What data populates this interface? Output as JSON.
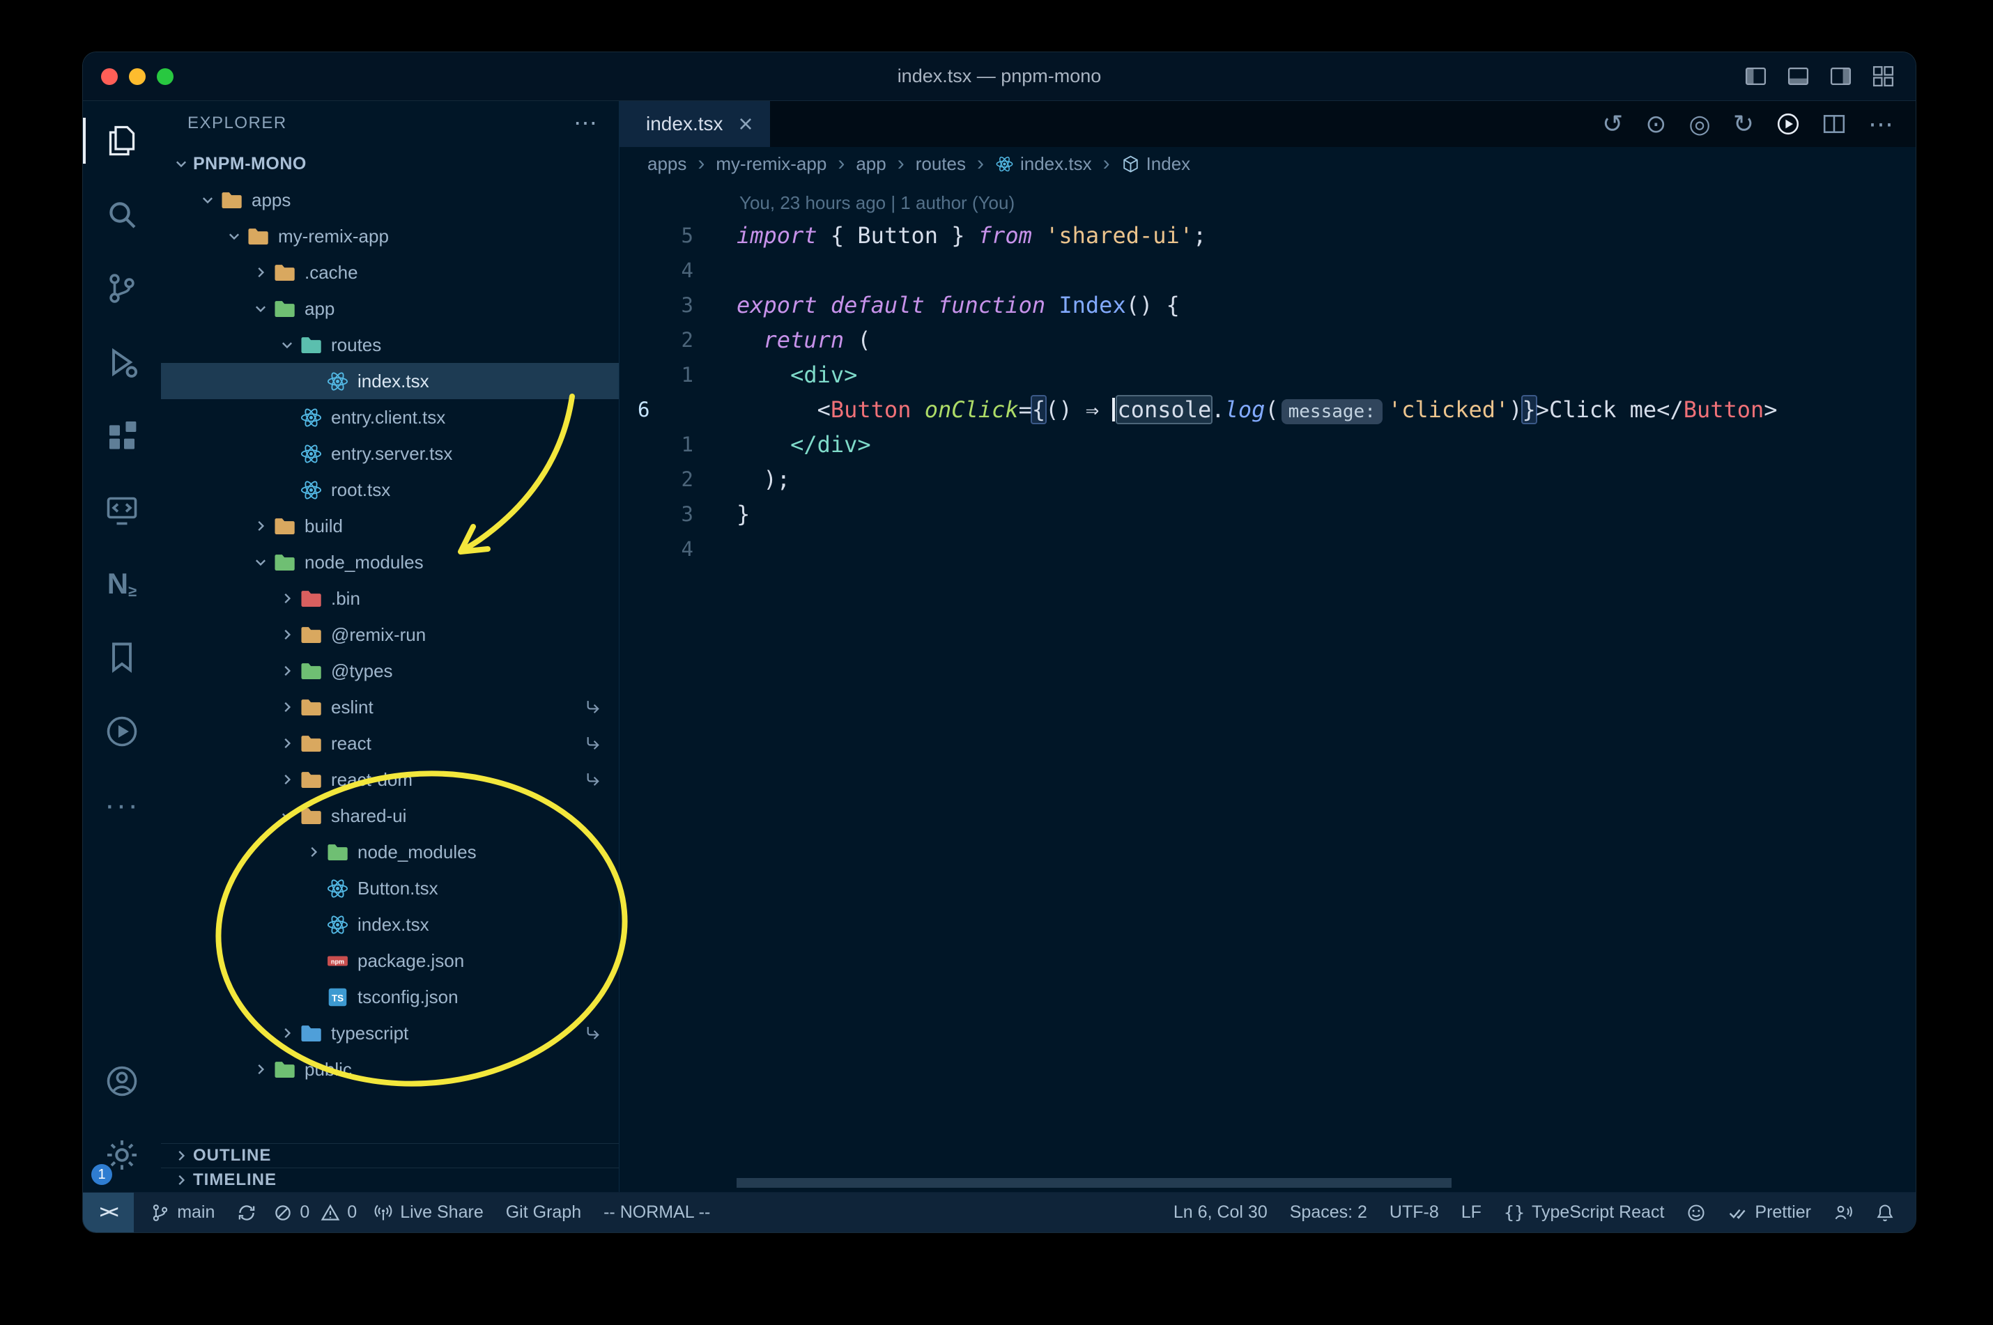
{
  "window": {
    "title": "index.tsx — pnpm-mono"
  },
  "activity_bar": {
    "top": [
      {
        "id": "explorer",
        "active": true
      },
      {
        "id": "search"
      },
      {
        "id": "source-control"
      },
      {
        "id": "run-and-debug"
      },
      {
        "id": "extensions"
      },
      {
        "id": "remote-explorer"
      },
      {
        "id": "nx-console"
      },
      {
        "id": "bookmarks"
      },
      {
        "id": "code-runner"
      },
      {
        "id": "more-views"
      }
    ],
    "bottom": [
      {
        "id": "accounts"
      },
      {
        "id": "settings",
        "badge": "1"
      }
    ]
  },
  "sidebar": {
    "header": "EXPLORER",
    "header_actions": "⋯",
    "tree": [
      {
        "label": "PNPM-MONO",
        "depth": 0,
        "chevron": "down",
        "root": true
      },
      {
        "label": "apps",
        "depth": 1,
        "chevron": "down",
        "icon": "folder",
        "color": "#d9a85f"
      },
      {
        "label": "my-remix-app",
        "depth": 2,
        "chevron": "down",
        "icon": "folder",
        "color": "#d9a85f"
      },
      {
        "label": ".cache",
        "depth": 3,
        "chevron": "right",
        "icon": "folder",
        "color": "#d9a85f"
      },
      {
        "label": "app",
        "depth": 3,
        "chevron": "down",
        "icon": "folder",
        "color": "#6fbf73"
      },
      {
        "label": "routes",
        "depth": 4,
        "chevron": "down",
        "icon": "folder",
        "color": "#5bbfae"
      },
      {
        "label": "index.tsx",
        "depth": 5,
        "icon": "react",
        "selected": true
      },
      {
        "label": "entry.client.tsx",
        "depth": 4,
        "icon": "react"
      },
      {
        "label": "entry.server.tsx",
        "depth": 4,
        "icon": "react"
      },
      {
        "label": "root.tsx",
        "depth": 4,
        "icon": "react"
      },
      {
        "label": "build",
        "depth": 3,
        "chevron": "right",
        "icon": "folder",
        "color": "#d9a85f"
      },
      {
        "label": "node_modules",
        "depth": 3,
        "chevron": "down",
        "icon": "folder",
        "color": "#6fbf73"
      },
      {
        "label": ".bin",
        "depth": 4,
        "chevron": "right",
        "icon": "folder",
        "color": "#d95f5f"
      },
      {
        "label": "@remix-run",
        "depth": 4,
        "chevron": "right",
        "icon": "folder",
        "color": "#d9a85f"
      },
      {
        "label": "@types",
        "depth": 4,
        "chevron": "right",
        "icon": "folder",
        "color": "#6fbf73"
      },
      {
        "label": "eslint",
        "depth": 4,
        "chevron": "right",
        "icon": "folder",
        "color": "#d9a85f",
        "symlink": true
      },
      {
        "label": "react",
        "depth": 4,
        "chevron": "right",
        "icon": "folder",
        "color": "#d9a85f",
        "symlink": true
      },
      {
        "label": "react-dom",
        "depth": 4,
        "chevron": "right",
        "icon": "folder",
        "color": "#d9a85f",
        "symlink": true
      },
      {
        "label": "shared-ui",
        "depth": 4,
        "chevron": "down",
        "icon": "folder",
        "color": "#d9a85f"
      },
      {
        "label": "node_modules",
        "depth": 5,
        "chevron": "right",
        "icon": "folder",
        "color": "#6fbf73"
      },
      {
        "label": "Button.tsx",
        "depth": 5,
        "icon": "react"
      },
      {
        "label": "index.tsx",
        "depth": 5,
        "icon": "react"
      },
      {
        "label": "package.json",
        "depth": 5,
        "icon": "npm"
      },
      {
        "label": "tsconfig.json",
        "depth": 5,
        "icon": "ts"
      },
      {
        "label": "typescript",
        "depth": 4,
        "chevron": "right",
        "icon": "folder",
        "color": "#4f9fd9",
        "symlink": true
      },
      {
        "label": "public",
        "depth": 3,
        "chevron": "right",
        "icon": "folder",
        "color": "#6fbf73"
      }
    ],
    "panels": [
      {
        "label": "OUTLINE"
      },
      {
        "label": "TIMELINE"
      }
    ]
  },
  "editor": {
    "tab": {
      "label": "index.tsx",
      "icon": "react"
    },
    "actions": [
      {
        "id": "file-history",
        "glyph": "↺"
      },
      {
        "id": "gitlens-compare",
        "glyph": "⊙"
      },
      {
        "id": "gitlens-graph",
        "glyph": "◎"
      },
      {
        "id": "gitlens-blame",
        "glyph": "↻"
      },
      {
        "id": "run-code",
        "glyph": "play-circle",
        "bright": true
      },
      {
        "id": "split-editor",
        "glyph": "split"
      },
      {
        "id": "more-actions",
        "glyph": "⋯"
      }
    ],
    "breadcrumbs": [
      {
        "label": "apps"
      },
      {
        "label": "my-remix-app"
      },
      {
        "label": "app"
      },
      {
        "label": "routes"
      },
      {
        "label": "index.tsx",
        "icon": "react"
      },
      {
        "label": "Index",
        "icon": "cube"
      }
    ],
    "blame": "You, 23 hours ago | 1 author (You)",
    "code_lines": [
      {
        "num": "5",
        "segments": [
          {
            "t": "import",
            "c": "keyword"
          },
          {
            "t": " { Button } ",
            "c": "plain"
          },
          {
            "t": "from",
            "c": "keyword"
          },
          {
            "t": " ",
            "c": "plain"
          },
          {
            "t": "'shared-ui'",
            "c": "string"
          },
          {
            "t": ";",
            "c": "plain"
          }
        ]
      },
      {
        "num": "4",
        "segments": []
      },
      {
        "num": "3",
        "segments": [
          {
            "t": "export",
            "c": "keyword"
          },
          {
            "t": " ",
            "c": "plain"
          },
          {
            "t": "default",
            "c": "keyword"
          },
          {
            "t": " ",
            "c": "plain"
          },
          {
            "t": "function",
            "c": "keyword"
          },
          {
            "t": " ",
            "c": "plain"
          },
          {
            "t": "Index",
            "c": "function"
          },
          {
            "t": "() {",
            "c": "plain"
          }
        ]
      },
      {
        "num": "2",
        "segments": [
          {
            "t": "  ",
            "c": "plain"
          },
          {
            "t": "return",
            "c": "keyword"
          },
          {
            "t": " (",
            "c": "plain"
          }
        ]
      },
      {
        "num": "1",
        "segments": [
          {
            "t": "    ",
            "c": "plain"
          },
          {
            "t": "<div>",
            "c": "tag"
          }
        ]
      },
      {
        "num": "6",
        "current": true,
        "segments": [
          {
            "t": "      <",
            "c": "plain"
          },
          {
            "t": "Button",
            "c": "component"
          },
          {
            "t": " ",
            "c": "plain"
          },
          {
            "t": "onClick",
            "c": "attribute"
          },
          {
            "t": "=",
            "c": "plain"
          },
          {
            "t": "{",
            "c": "plain bracket-hl"
          },
          {
            "t": "() ",
            "c": "plain"
          },
          {
            "t": "⇒",
            "c": "plain"
          },
          {
            "t": " ",
            "c": "plain"
          },
          {
            "caret": true
          },
          {
            "t": "console",
            "c": "plain word-hl"
          },
          {
            "t": ".",
            "c": "plain"
          },
          {
            "t": "log",
            "c": "function italic"
          },
          {
            "t": "(",
            "c": "plain"
          },
          {
            "t": "message:",
            "c": "inlay"
          },
          {
            "t": "'clicked'",
            "c": "string"
          },
          {
            "t": ")",
            "c": "plain"
          },
          {
            "t": "}",
            "c": "plain bracket-hl"
          },
          {
            "t": ">Click me</",
            "c": "plain"
          },
          {
            "t": "Button",
            "c": "component"
          },
          {
            "t": ">",
            "c": "plain"
          }
        ]
      },
      {
        "num": "1",
        "segments": [
          {
            "t": "    ",
            "c": "plain"
          },
          {
            "t": "</div>",
            "c": "tag"
          }
        ]
      },
      {
        "num": "2",
        "segments": [
          {
            "t": "  );",
            "c": "plain"
          }
        ]
      },
      {
        "num": "3",
        "segments": [
          {
            "t": "}",
            "c": "plain"
          }
        ]
      },
      {
        "num": "4",
        "segments": []
      }
    ]
  },
  "status_bar": {
    "left": [
      {
        "id": "remote",
        "icon": "remote-glyph",
        "boxed": true
      },
      {
        "id": "branch",
        "icon": "branch",
        "label": "main"
      },
      {
        "id": "sync",
        "icon": "sync"
      },
      {
        "id": "problems-errors",
        "icon": "error",
        "label": "0",
        "tight": true
      },
      {
        "id": "problems-warnings",
        "icon": "warning",
        "label": "0",
        "tight": true
      },
      {
        "id": "live-share",
        "icon": "antenna",
        "label": "Live Share"
      },
      {
        "id": "git-graph",
        "label": "Git Graph"
      },
      {
        "id": "vim-mode",
        "label": "-- NORMAL --"
      }
    ],
    "right": [
      {
        "id": "cursor-position",
        "label": "Ln 6, Col 30"
      },
      {
        "id": "indentation",
        "label": "Spaces: 2"
      },
      {
        "id": "encoding",
        "label": "UTF-8"
      },
      {
        "id": "eol",
        "label": "LF"
      },
      {
        "id": "language-mode",
        "icon": "braces",
        "label": "TypeScript React"
      },
      {
        "id": "feedback",
        "icon": "smiley"
      },
      {
        "id": "formatter",
        "icon": "check-double",
        "label": "Prettier"
      },
      {
        "id": "screen-reader",
        "icon": "person-voice"
      },
      {
        "id": "notifications",
        "icon": "bell"
      }
    ]
  },
  "annotations": {
    "color": "#f3e73c"
  }
}
